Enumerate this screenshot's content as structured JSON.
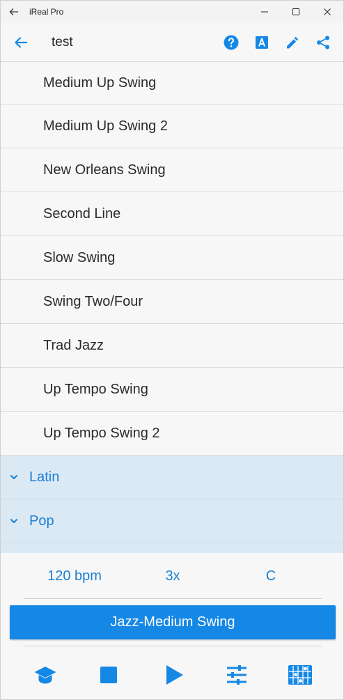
{
  "window": {
    "title": "iReal Pro"
  },
  "header": {
    "title": "test"
  },
  "styles": [
    "Medium Up Swing",
    "Medium Up Swing 2",
    "New Orleans Swing",
    "Second Line",
    "Slow Swing",
    "Swing Two/Four",
    "Trad Jazz",
    "Up Tempo Swing",
    "Up Tempo Swing 2"
  ],
  "categories": [
    "Latin",
    "Pop"
  ],
  "controls": {
    "tempo": "120 bpm",
    "repeats": "3x",
    "key": "C"
  },
  "selected_style": "Jazz-Medium Swing",
  "colors": {
    "accent": "#1588e6",
    "category_bg": "#dbe9f5",
    "background": "#f7f7f7"
  },
  "icons": {
    "header": [
      "help-icon",
      "font-icon",
      "edit-icon",
      "share-icon"
    ],
    "bottom": [
      "practice-icon",
      "stop-icon",
      "play-icon",
      "mixer-icon",
      "chord-diagram-icon"
    ]
  }
}
